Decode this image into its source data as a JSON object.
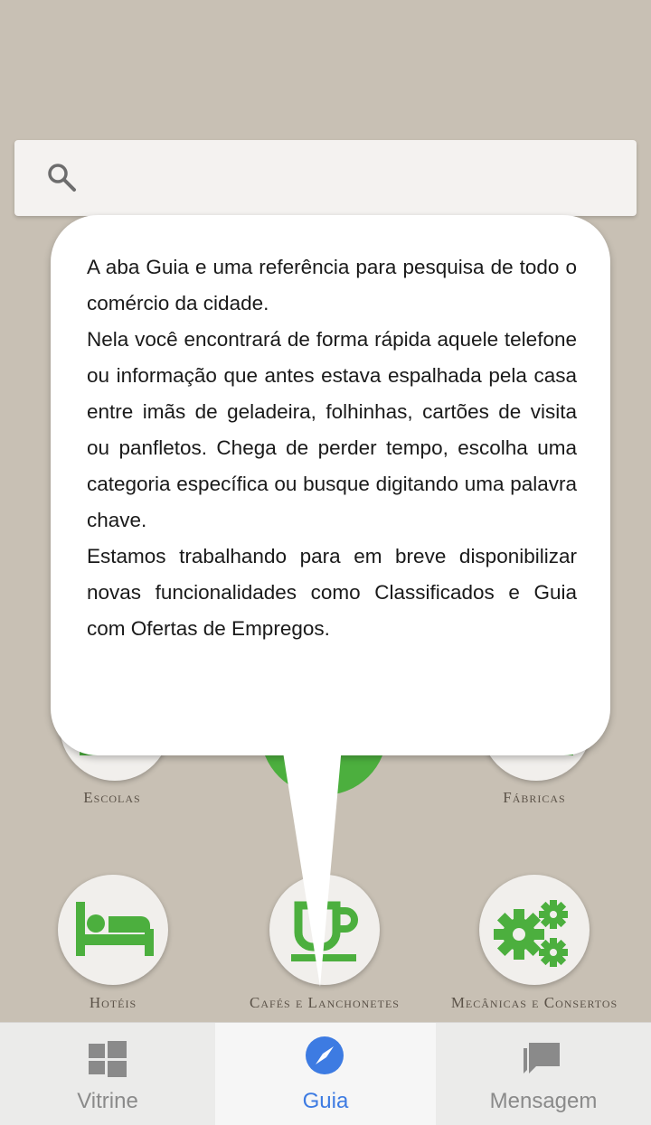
{
  "search": {
    "placeholder": "",
    "icon": "search-icon"
  },
  "categories": [
    {
      "label": "Escolas",
      "icon": "school-icon"
    },
    {
      "label": "Fábricas",
      "icon": "factory-icon"
    },
    {
      "label": "Hotéis",
      "icon": "bed-icon"
    },
    {
      "label": "Cafés e Lanchonetes",
      "icon": "coffee-cup-icon"
    },
    {
      "label": "Mecânicas e Consertos",
      "icon": "gears-icon"
    }
  ],
  "tooltip": {
    "paragraphs": [
      "A aba Guia e uma referência para pesquisa de todo o comércio da cidade.",
      "Nela você encontrará de forma rápida aquele telefone ou informação que antes estava espalhada pela casa entre imãs de geladeira, folhinhas, cartões de visita ou panfletos. Chega de perder tempo, escolha uma categoria específica ou busque digitando uma palavra chave.",
      "Estamos trabalhando para em breve disponibilizar novas funcionalidades como Classificados e Guia com Ofertas de Empregos."
    ]
  },
  "tabs": [
    {
      "label": "Vitrine",
      "icon": "windows-icon",
      "active": false
    },
    {
      "label": "Guia",
      "icon": "compass-icon",
      "active": true
    },
    {
      "label": "Mensagem",
      "icon": "chat-icon",
      "active": false
    }
  ],
  "colors": {
    "accent": "#3d7be2",
    "category_green": "#4caf3e",
    "background": "#c8c0b4"
  }
}
